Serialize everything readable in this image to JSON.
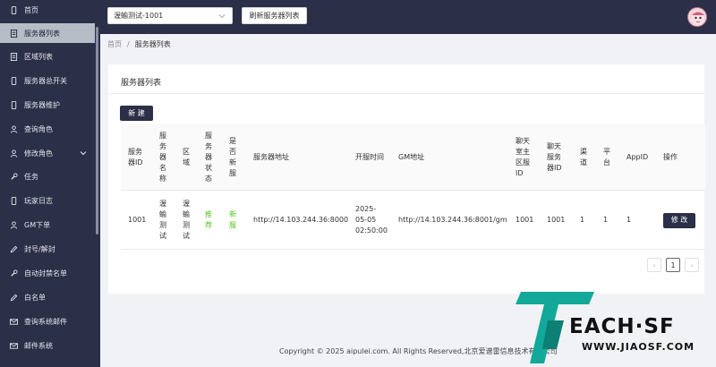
{
  "sidebar": {
    "items": [
      {
        "label": "首页",
        "icon": "phone-icon"
      },
      {
        "label": "服务器列表",
        "icon": "document-icon",
        "active": true
      },
      {
        "label": "区域列表",
        "icon": "document-icon"
      },
      {
        "label": "服务器总开关",
        "icon": "phone-icon"
      },
      {
        "label": "服务器维护",
        "icon": "phone-icon"
      },
      {
        "label": "查询角色",
        "icon": "user-icon"
      },
      {
        "label": "修改角色",
        "icon": "user-icon",
        "expandable": true
      },
      {
        "label": "任务",
        "icon": "wrench-icon"
      },
      {
        "label": "玩家日志",
        "icon": "phone-icon"
      },
      {
        "label": "GM下单",
        "icon": "user-icon"
      },
      {
        "label": "封号/解封",
        "icon": "pencil-icon"
      },
      {
        "label": "自动封禁名单",
        "icon": "wrench-icon"
      },
      {
        "label": "白名单",
        "icon": "pencil-icon"
      },
      {
        "label": "查询系统邮件",
        "icon": "mail-icon"
      },
      {
        "label": "邮件系统",
        "icon": "mail-icon"
      }
    ]
  },
  "header": {
    "server_select_value": "渥蝓测试-1001",
    "refresh_label": "刷新服务器列表"
  },
  "breadcrumb": {
    "home": "首页",
    "separator": "/",
    "current": "服务器列表"
  },
  "card": {
    "title": "服务器列表",
    "new_button": "新 建"
  },
  "table": {
    "headers": [
      [
        "服务",
        "器ID"
      ],
      [
        "服",
        "务",
        "器",
        "名",
        "称"
      ],
      [
        "区",
        "域"
      ],
      [
        "服",
        "务",
        "器",
        "状",
        "态"
      ],
      [
        "是",
        "否",
        "新",
        "服"
      ],
      [
        "服务器地址"
      ],
      [
        "开服时间"
      ],
      [
        "GM地址"
      ],
      [
        "聊天",
        "室主",
        "区服",
        "ID"
      ],
      [
        "聊天",
        "服务",
        "器ID"
      ],
      [
        "渠",
        "道"
      ],
      [
        "平",
        "台"
      ],
      [
        "AppID"
      ],
      [
        "操作"
      ]
    ],
    "row": {
      "server_id": "1001",
      "server_name": [
        "渥",
        "蝓",
        "测",
        "试"
      ],
      "region": [
        "渥",
        "蝓",
        "测",
        "试"
      ],
      "status": [
        "推",
        "荐"
      ],
      "is_new": [
        "新",
        "服"
      ],
      "server_addr": "http://14.103.244.36:8000",
      "open_time": [
        "2025-",
        "05-05",
        "02:50:00"
      ],
      "gm_addr": "http://14.103.244.36:8001/gm",
      "chat_main_id": "1001",
      "chat_server_id": "1001",
      "channel": "1",
      "platform": "1",
      "app_id": "1",
      "action": "修 改"
    }
  },
  "pagination": {
    "prev": "‹",
    "current": "1",
    "next": "›"
  },
  "footer": {
    "text": "Copyright © 2025 aipulei.com. All Rights Reserved,北京爱谱雷信息技术有限公司"
  },
  "watermark": {
    "brand": "EACH·SF",
    "url": "WWW.JIAOSF.COM"
  },
  "colors": {
    "sidebar_bg": "#2c2f48",
    "active_item_bg": "#b8bcc6",
    "primary_button": "#2c2f48",
    "status_green": "#52c41a",
    "watermark_teal": "#12a89a"
  }
}
